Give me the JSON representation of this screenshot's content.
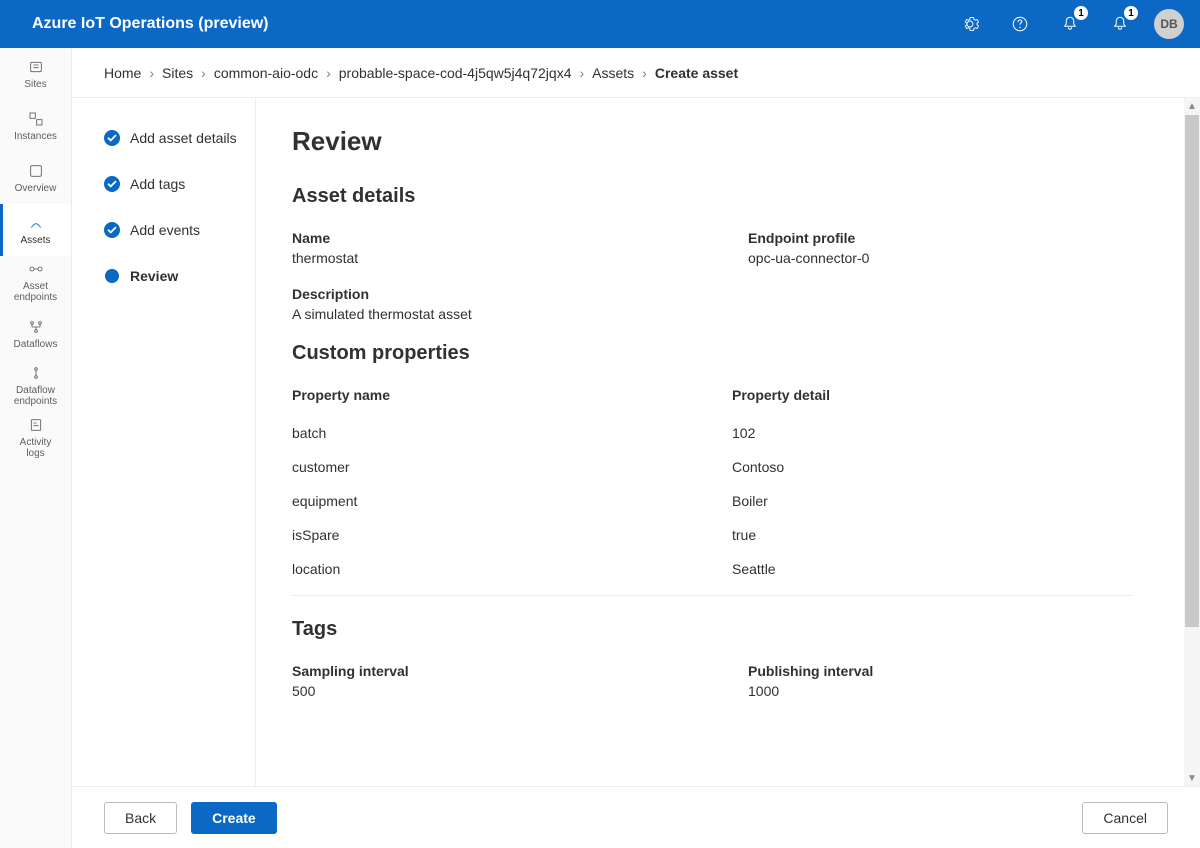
{
  "header": {
    "appTitle": "Azure IoT Operations (preview)",
    "notifBadge1": "1",
    "notifBadge2": "1",
    "userInitials": "DB"
  },
  "sidenav": [
    {
      "id": "sites",
      "label": "Sites"
    },
    {
      "id": "instances",
      "label": "Instances"
    },
    {
      "id": "overview",
      "label": "Overview"
    },
    {
      "id": "assets",
      "label": "Assets",
      "active": true
    },
    {
      "id": "asset-endpoints",
      "label": "Asset\nendpoints"
    },
    {
      "id": "dataflows",
      "label": "Dataflows"
    },
    {
      "id": "dataflow-endpoints",
      "label": "Dataflow\nendpoints"
    },
    {
      "id": "activity-logs",
      "label": "Activity\nlogs"
    }
  ],
  "breadcrumb": {
    "items": [
      "Home",
      "Sites",
      "common-aio-odc",
      "probable-space-cod-4j5qw5j4q72jqx4",
      "Assets"
    ],
    "current": "Create asset"
  },
  "steps": [
    {
      "label": "Add asset details",
      "done": true
    },
    {
      "label": "Add tags",
      "done": true
    },
    {
      "label": "Add events",
      "done": true
    },
    {
      "label": "Review",
      "active": true
    }
  ],
  "review": {
    "title": "Review",
    "assetDetails": {
      "heading": "Asset details",
      "name": {
        "label": "Name",
        "value": "thermostat"
      },
      "endpointProfile": {
        "label": "Endpoint profile",
        "value": "opc-ua-connector-0"
      },
      "description": {
        "label": "Description",
        "value": "A simulated thermostat asset"
      }
    },
    "customProperties": {
      "heading": "Custom properties",
      "nameHeader": "Property name",
      "detailHeader": "Property detail",
      "rows": [
        {
          "name": "batch",
          "detail": "102"
        },
        {
          "name": "customer",
          "detail": "Contoso"
        },
        {
          "name": "equipment",
          "detail": "Boiler"
        },
        {
          "name": "isSpare",
          "detail": "true"
        },
        {
          "name": "location",
          "detail": "Seattle"
        }
      ]
    },
    "tags": {
      "heading": "Tags",
      "sampling": {
        "label": "Sampling interval",
        "value": "500"
      },
      "publishing": {
        "label": "Publishing interval",
        "value": "1000"
      }
    }
  },
  "footer": {
    "back": "Back",
    "create": "Create",
    "cancel": "Cancel"
  }
}
